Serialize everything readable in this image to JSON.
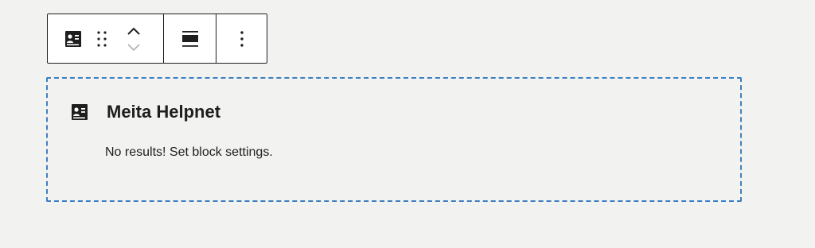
{
  "toolbar": {
    "block_icon": "contact-card-icon",
    "drag_icon": "drag-handle-icon",
    "move_up_icon": "chevron-up-icon",
    "move_down_icon": "chevron-down-icon",
    "align_icon": "align-center-icon",
    "more_icon": "more-vertical-icon"
  },
  "block": {
    "icon": "contact-card-icon",
    "title": "Meita Helpnet",
    "message": "No results! Set block settings."
  },
  "colors": {
    "background": "#f2f2f0",
    "selection_border": "#3c7fc0",
    "text": "#1e1e1e",
    "disabled_icon": "#b0b0b0"
  }
}
